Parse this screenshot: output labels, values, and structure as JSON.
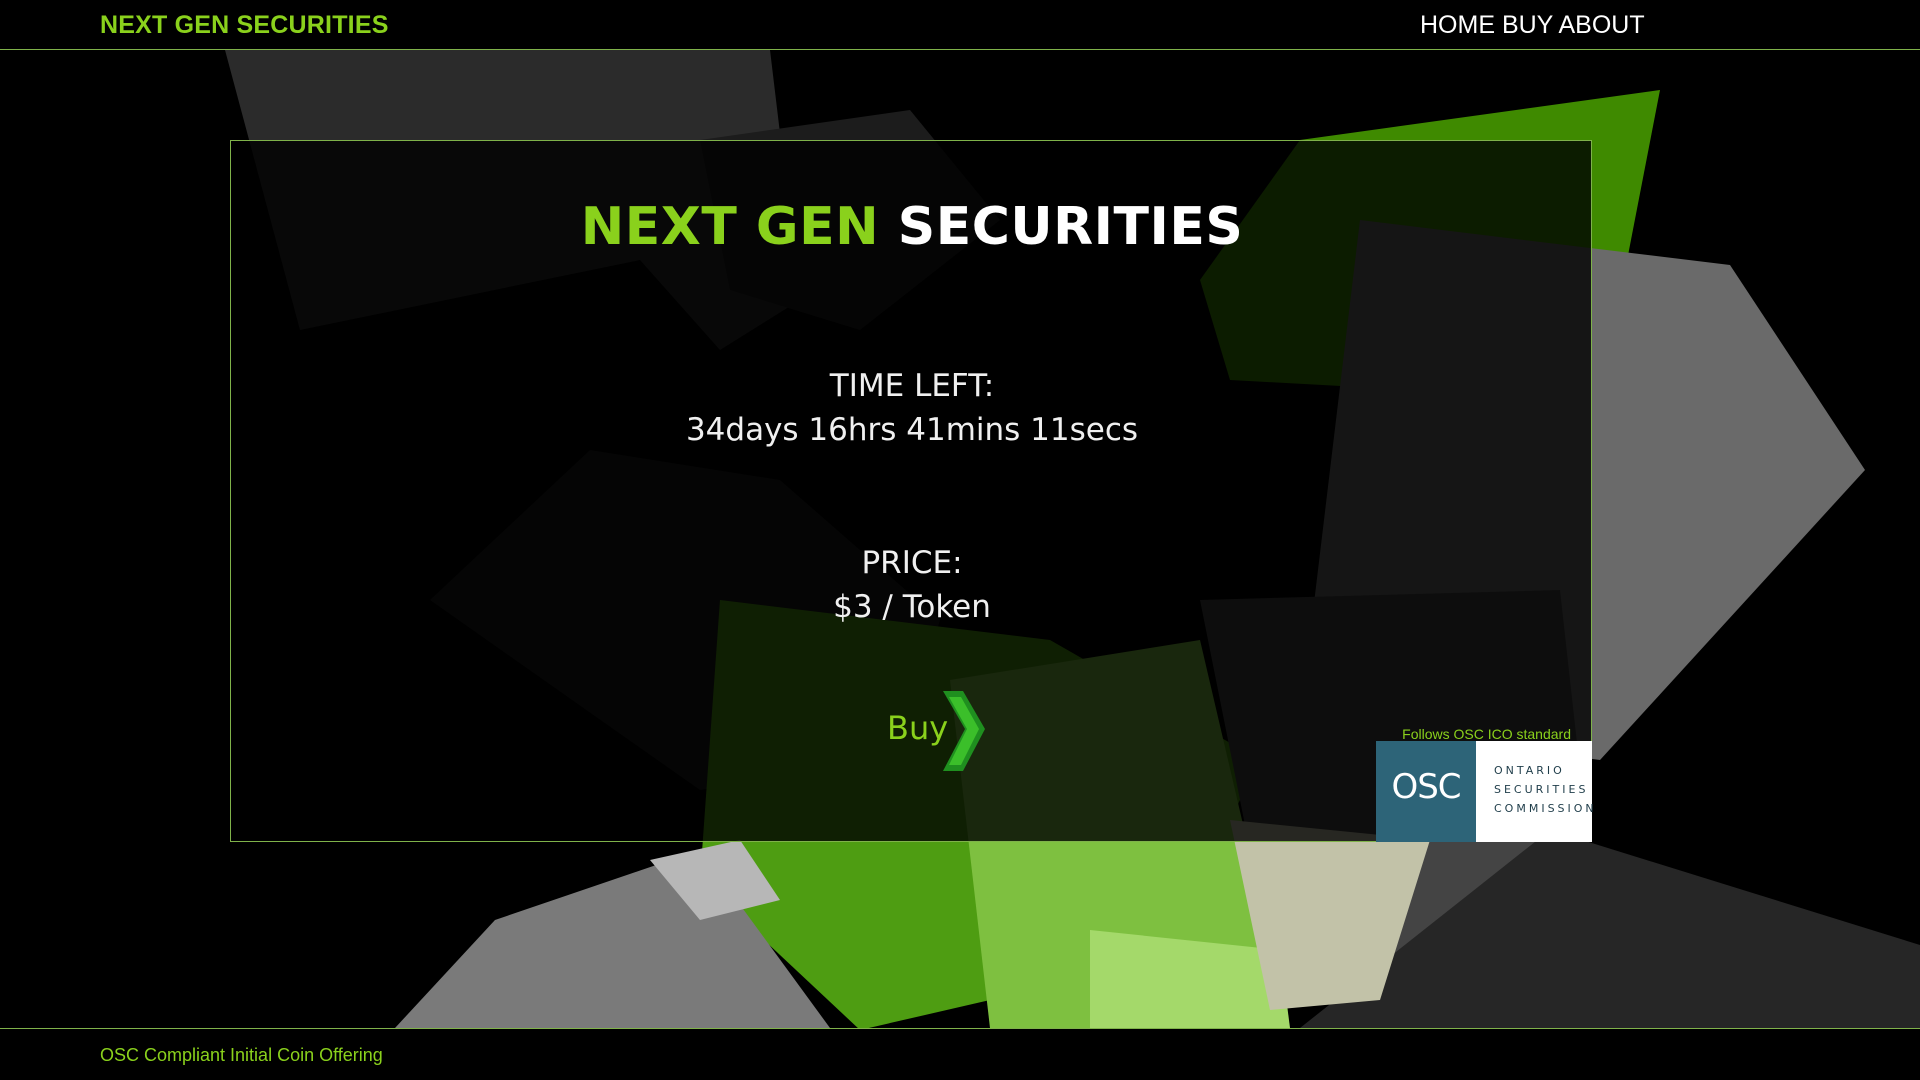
{
  "header": {
    "brand": "NEXT GEN SECURITIES",
    "nav": {
      "home": "HOME",
      "buy": "BUY",
      "about": "ABOUT"
    }
  },
  "hero": {
    "title_green": "NEXT GEN",
    "title_white": "SECURITIES",
    "time_left_label": "TIME LEFT:",
    "time_left_value": "34days 16hrs 41mins 11secs",
    "price_label": "PRICE:",
    "price_value": "$3 / Token",
    "buy_label": "Buy"
  },
  "osc": {
    "note": "Follows OSC ICO standard",
    "abbr": "OSC",
    "line1": "ONTARIO",
    "line2": "SECURITIES",
    "line3": "COMMISSION"
  },
  "footer": {
    "text": "OSC Compliant Initial Coin Offering"
  },
  "colors": {
    "accent": "#8ad11c",
    "border": "#7fb24a",
    "osc_blue": "#2d6478"
  },
  "icons": {
    "buy": "chevron-right-icon"
  }
}
